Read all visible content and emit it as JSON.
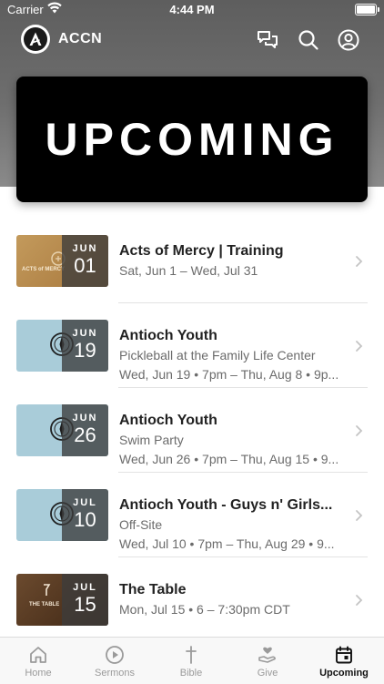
{
  "status": {
    "carrier": "Carrier",
    "time": "4:44 PM"
  },
  "header": {
    "app_name": "ACCN",
    "icons": [
      "chat-bubbles-icon",
      "search-icon",
      "profile-icon"
    ]
  },
  "banner": {
    "title": "UPCOMING"
  },
  "events": [
    {
      "title": "Acts of Mercy | Training",
      "line1": "Sat, Jun 1 – Wed, Jul 31",
      "line2": "",
      "month": "JUN",
      "day": "01",
      "thumb_color": "#b88a4e",
      "thumb_label": "ACTS of MERCY"
    },
    {
      "title": "Antioch Youth",
      "line1": "Pickleball at the Family Life Center",
      "line2": "Wed, Jun 19 • 7pm – Thu, Aug 8 • 9p...",
      "month": "JUN",
      "day": "19",
      "thumb_color": "#a9ccd9",
      "thumb_label": ""
    },
    {
      "title": "Antioch Youth",
      "line1": "Swim Party",
      "line2": "Wed, Jun 26 • 7pm – Thu, Aug 15 • 9...",
      "month": "JUN",
      "day": "26",
      "thumb_color": "#a9ccd9",
      "thumb_label": ""
    },
    {
      "title": "Antioch Youth - Guys n' Girls...",
      "line1": "Off-Site",
      "line2": "Wed, Jul 10 • 7pm – Thu, Aug 29 • 9...",
      "month": "JUL",
      "day": "10",
      "thumb_color": "#a9ccd9",
      "thumb_label": ""
    },
    {
      "title": "The Table",
      "line1": "Mon, Jul 15 • 6 – 7:30pm CDT",
      "line2": "",
      "month": "JUL",
      "day": "15",
      "thumb_color": "#5a3a22",
      "thumb_label": "THE TABLE"
    }
  ],
  "tabs": [
    {
      "label": "Home",
      "icon": "home-icon",
      "active": false
    },
    {
      "label": "Sermons",
      "icon": "play-circle-icon",
      "active": false
    },
    {
      "label": "Bible",
      "icon": "cross-icon",
      "active": false
    },
    {
      "label": "Give",
      "icon": "hand-heart-icon",
      "active": false
    },
    {
      "label": "Upcoming",
      "icon": "calendar-icon",
      "active": true
    }
  ],
  "colors": {
    "header_gray": "#6e6e6e",
    "active_tab": "#111111",
    "inactive_tab": "#9a9a9a"
  }
}
